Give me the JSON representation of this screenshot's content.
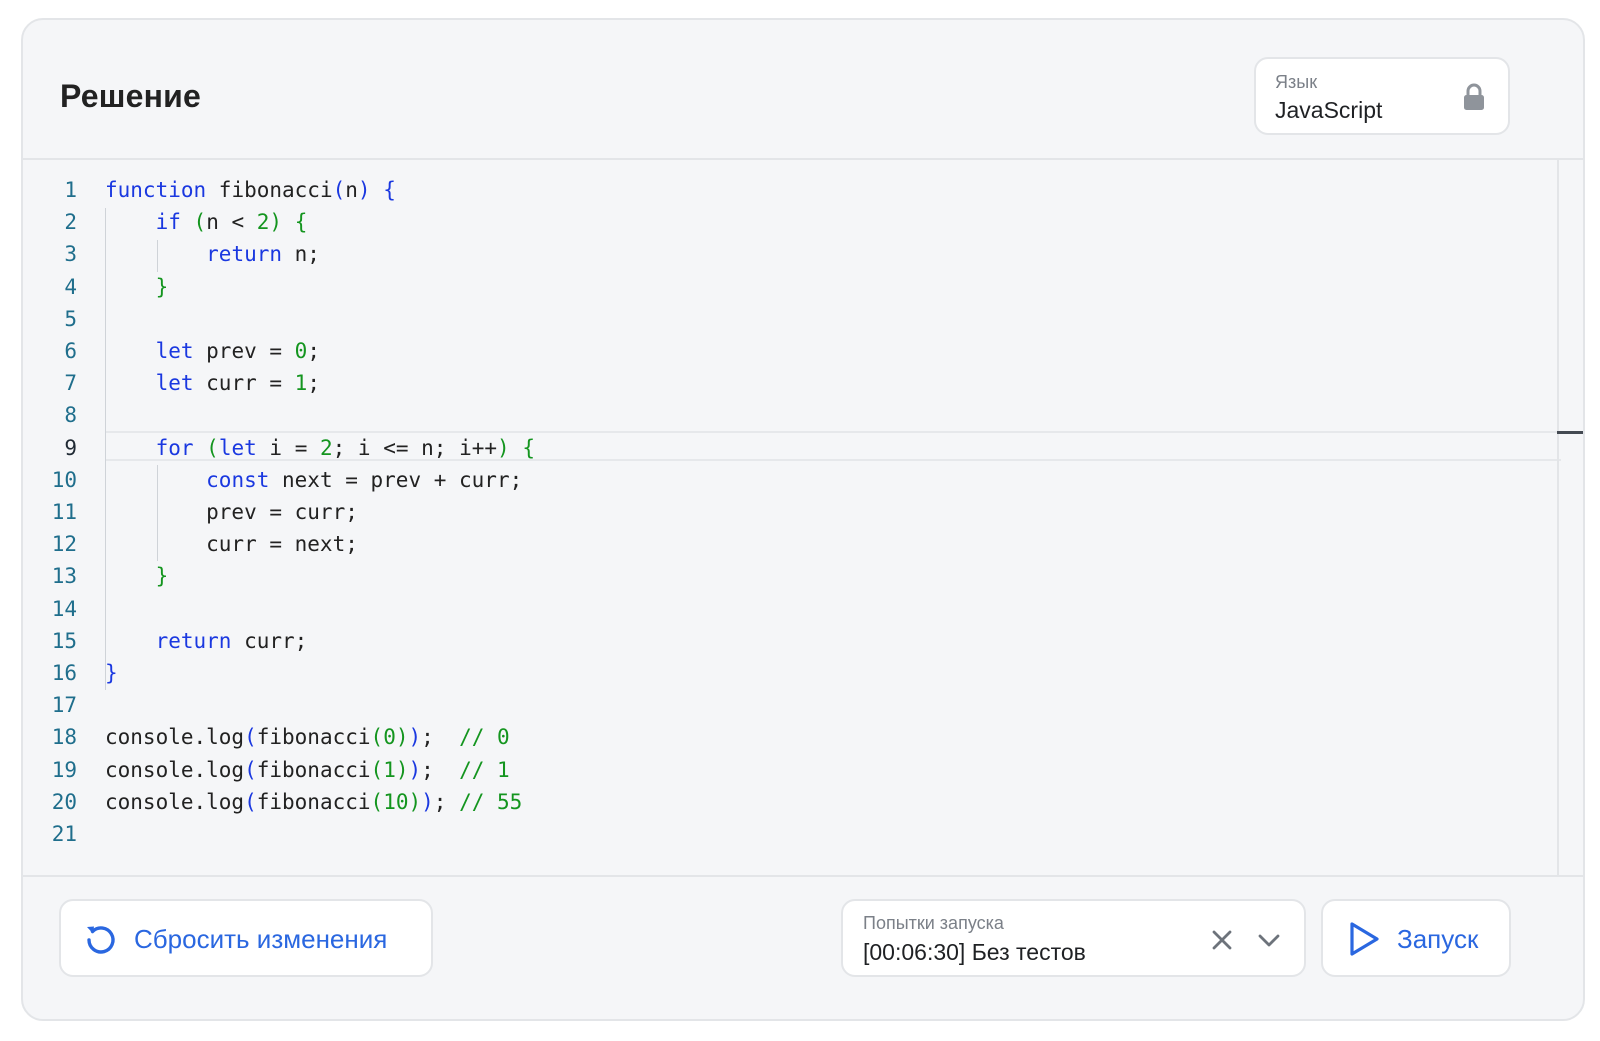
{
  "header": {
    "title": "Решение",
    "language": {
      "label": "Язык",
      "value": "JavaScript",
      "icon": "lock-icon"
    }
  },
  "editor": {
    "current_line": 9,
    "lines": [
      {
        "n": "1",
        "tokens": [
          [
            "kw",
            "function"
          ],
          [
            "pl",
            " fibonacci"
          ],
          [
            "br1",
            "("
          ],
          [
            "pl",
            "n"
          ],
          [
            "br1",
            ")"
          ],
          [
            "pl",
            " "
          ],
          [
            "br1",
            "{"
          ]
        ]
      },
      {
        "n": "2",
        "tokens": [
          [
            "pl",
            "    "
          ],
          [
            "kw",
            "if"
          ],
          [
            "pl",
            " "
          ],
          [
            "br2",
            "("
          ],
          [
            "pl",
            "n < "
          ],
          [
            "num",
            "2"
          ],
          [
            "br2",
            ")"
          ],
          [
            "pl",
            " "
          ],
          [
            "br2",
            "{"
          ]
        ]
      },
      {
        "n": "3",
        "tokens": [
          [
            "pl",
            "        "
          ],
          [
            "kw",
            "return"
          ],
          [
            "pl",
            " n;"
          ]
        ]
      },
      {
        "n": "4",
        "tokens": [
          [
            "pl",
            "    "
          ],
          [
            "br2",
            "}"
          ]
        ]
      },
      {
        "n": "5",
        "tokens": []
      },
      {
        "n": "6",
        "tokens": [
          [
            "pl",
            "    "
          ],
          [
            "kw",
            "let"
          ],
          [
            "pl",
            " prev = "
          ],
          [
            "num",
            "0"
          ],
          [
            "pl",
            ";"
          ]
        ]
      },
      {
        "n": "7",
        "tokens": [
          [
            "pl",
            "    "
          ],
          [
            "kw",
            "let"
          ],
          [
            "pl",
            " curr = "
          ],
          [
            "num",
            "1"
          ],
          [
            "pl",
            ";"
          ]
        ]
      },
      {
        "n": "8",
        "tokens": []
      },
      {
        "n": "9",
        "tokens": [
          [
            "pl",
            "    "
          ],
          [
            "kw",
            "for"
          ],
          [
            "pl",
            " "
          ],
          [
            "br2",
            "("
          ],
          [
            "kw",
            "let"
          ],
          [
            "pl",
            " i = "
          ],
          [
            "num",
            "2"
          ],
          [
            "pl",
            "; i <= n; i++"
          ],
          [
            "br2",
            ")"
          ],
          [
            "pl",
            " "
          ],
          [
            "br2",
            "{"
          ]
        ]
      },
      {
        "n": "10",
        "tokens": [
          [
            "pl",
            "        "
          ],
          [
            "kw",
            "const"
          ],
          [
            "pl",
            " next = prev + curr;"
          ]
        ]
      },
      {
        "n": "11",
        "tokens": [
          [
            "pl",
            "        prev = curr;"
          ]
        ]
      },
      {
        "n": "12",
        "tokens": [
          [
            "pl",
            "        curr = next;"
          ]
        ]
      },
      {
        "n": "13",
        "tokens": [
          [
            "pl",
            "    "
          ],
          [
            "br2",
            "}"
          ]
        ]
      },
      {
        "n": "14",
        "tokens": []
      },
      {
        "n": "15",
        "tokens": [
          [
            "pl",
            "    "
          ],
          [
            "kw",
            "return"
          ],
          [
            "pl",
            " curr;"
          ]
        ]
      },
      {
        "n": "16",
        "tokens": [
          [
            "br1",
            "}"
          ]
        ]
      },
      {
        "n": "17",
        "tokens": []
      },
      {
        "n": "18",
        "tokens": [
          [
            "pl",
            "console.log"
          ],
          [
            "br1",
            "("
          ],
          [
            "pl",
            "fibonacci"
          ],
          [
            "br2",
            "("
          ],
          [
            "num",
            "0"
          ],
          [
            "br2",
            ")"
          ],
          [
            "br1",
            ")"
          ],
          [
            "pl",
            ";  "
          ],
          [
            "cm",
            "// 0"
          ]
        ]
      },
      {
        "n": "19",
        "tokens": [
          [
            "pl",
            "console.log"
          ],
          [
            "br1",
            "("
          ],
          [
            "pl",
            "fibonacci"
          ],
          [
            "br2",
            "("
          ],
          [
            "num",
            "1"
          ],
          [
            "br2",
            ")"
          ],
          [
            "br1",
            ")"
          ],
          [
            "pl",
            ";  "
          ],
          [
            "cm",
            "// 1"
          ]
        ]
      },
      {
        "n": "20",
        "tokens": [
          [
            "pl",
            "console.log"
          ],
          [
            "br1",
            "("
          ],
          [
            "pl",
            "fibonacci"
          ],
          [
            "br2",
            "("
          ],
          [
            "num",
            "10"
          ],
          [
            "br2",
            ")"
          ],
          [
            "br1",
            ")"
          ],
          [
            "pl",
            "; "
          ],
          [
            "cm",
            "// 55"
          ]
        ]
      },
      {
        "n": "21",
        "tokens": []
      }
    ]
  },
  "footer": {
    "reset_label": "Сбросить изменения",
    "reset_icon": "reset-icon",
    "attempts_label": "Попытки запуска",
    "attempts_value": "[00:06:30] Без тестов",
    "run_label": "Запуск",
    "run_icon": "play-icon"
  },
  "colors": {
    "accent": "#2a67e0",
    "keyword": "#1a38e0",
    "number": "#14951f",
    "line_number": "#1f6e8c"
  }
}
